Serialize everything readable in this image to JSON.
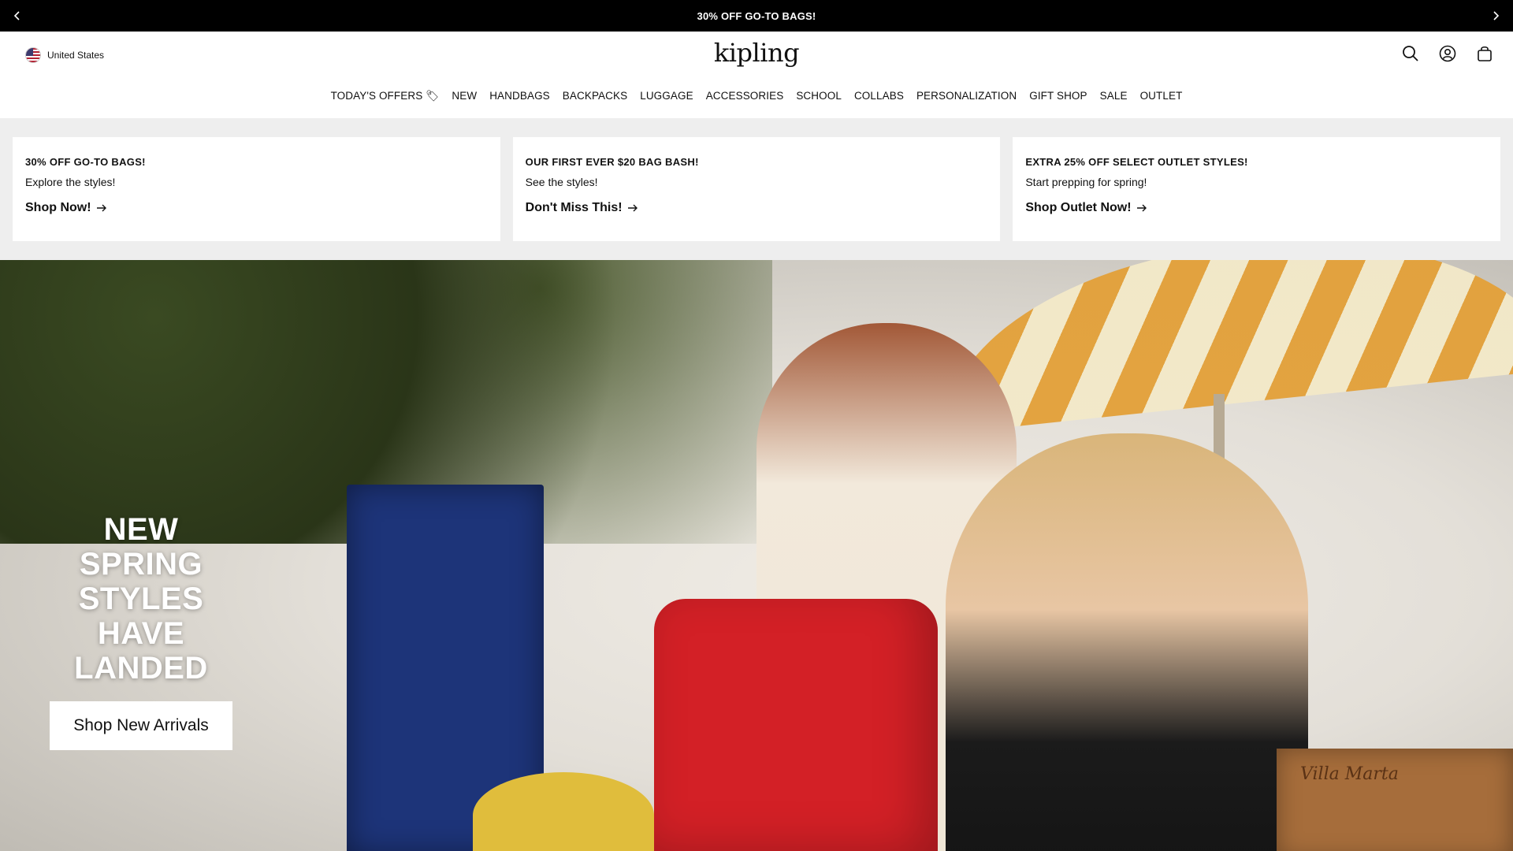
{
  "announcement": {
    "text": "30% OFF GO-TO BAGS!",
    "prev_icon": "chevron-left-icon",
    "next_icon": "chevron-right-icon"
  },
  "header": {
    "region": "United States",
    "region_icon": "us-flag-icon",
    "logo": "kipling",
    "icons": [
      "search-icon",
      "account-icon",
      "bag-icon"
    ]
  },
  "nav": {
    "items": [
      "TODAY'S OFFERS 🏷",
      "NEW",
      "HANDBAGS",
      "BACKPACKS",
      "LUGGAGE",
      "ACCESSORIES",
      "SCHOOL",
      "COLLABS",
      "PERSONALIZATION",
      "GIFT SHOP",
      "SALE",
      "OUTLET"
    ]
  },
  "promos": [
    {
      "title": "30% OFF GO-TO BAGS!",
      "subtitle": "Explore the styles!",
      "link": "Shop Now!"
    },
    {
      "title": "OUR FIRST EVER $20 BAG BASH!",
      "subtitle": "See the styles!",
      "link": "Don't Miss This!"
    },
    {
      "title": "EXTRA 25% OFF SELECT OUTLET STYLES!",
      "subtitle": "Start prepping for spring!",
      "link": "Shop Outlet Now!"
    }
  ],
  "hero": {
    "title": "NEW SPRING STYLES HAVE LANDED",
    "button": "Shop New Arrivals",
    "crate_label": "Villa Marta"
  },
  "colors": {
    "announcement_bg": "#000000",
    "promo_bg": "#eeeeee",
    "bag_red": "#d32026",
    "door_blue": "#1d3479"
  }
}
